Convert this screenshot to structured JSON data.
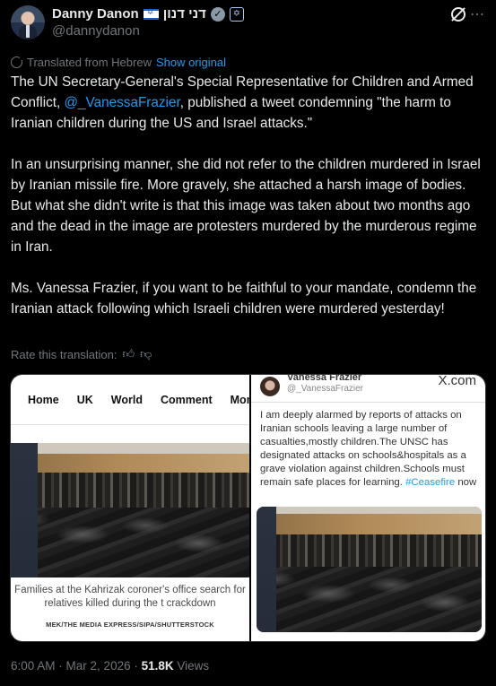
{
  "author": {
    "display_name": "Danny Danon",
    "hebrew_name": "דני דנון",
    "handle": "@dannydanon"
  },
  "icons": {
    "flag": "israel-flag-icon",
    "verified": "verified-badge-icon",
    "org": "affiliate-badge-icon",
    "grok": "grok-icon",
    "translate": "translate-icon"
  },
  "translation": {
    "from_label": "Translated from Hebrew",
    "show_original": "Show original"
  },
  "tweet": {
    "p1_before": "The UN Secretary-General's Special Representative for Children and Armed Conflict, ",
    "mention": "@_VanessaFrazier",
    "p1_after": ", published a tweet condemning \"the harm to Iranian children during the US and Israel attacks.\"",
    "p2": "In an unsurprising manner, she did not refer to the children murdered in Israel by Iranian missile fire. More gravely, she attached a harsh image of bodies. But what she didn't write is that this image was taken about two months ago and the dead in the image are protesters murdered by the murderous regime in Iran.",
    "p3": "Ms. Vanessa Frazier, if you want to be faithful to your mandate, condemn the Iranian attack following which Israeli children were murdered yesterday!"
  },
  "rate": {
    "label": "Rate this translation:"
  },
  "media_left": {
    "nav": [
      "Home",
      "UK",
      "World",
      "Comment",
      "Money"
    ],
    "caption": "Families at the Kahrizak coroner's office search for relatives killed during the t crackdown",
    "credit": "MEK/THE MEDIA EXPRESS/SIPA/SHUTTERSTOCK"
  },
  "media_right": {
    "name": "Vanessa Frazier",
    "handle": "@_VanessaFrazier",
    "x_label": "X.com",
    "text": "I am deeply alarmed by reports of attacks on Iranian schools leaving a large number of casualties,mostly children.The UNSC has designated attacks on schools&hospitals as a grave violation against children.Schools must remain safe places for learning. ",
    "hashtag": "#Ceasefire",
    "text_end": " now"
  },
  "meta": {
    "time": "6:00 AM",
    "date": "Mar 2, 2026",
    "views_count": "51.8K",
    "views_label": "Views"
  }
}
